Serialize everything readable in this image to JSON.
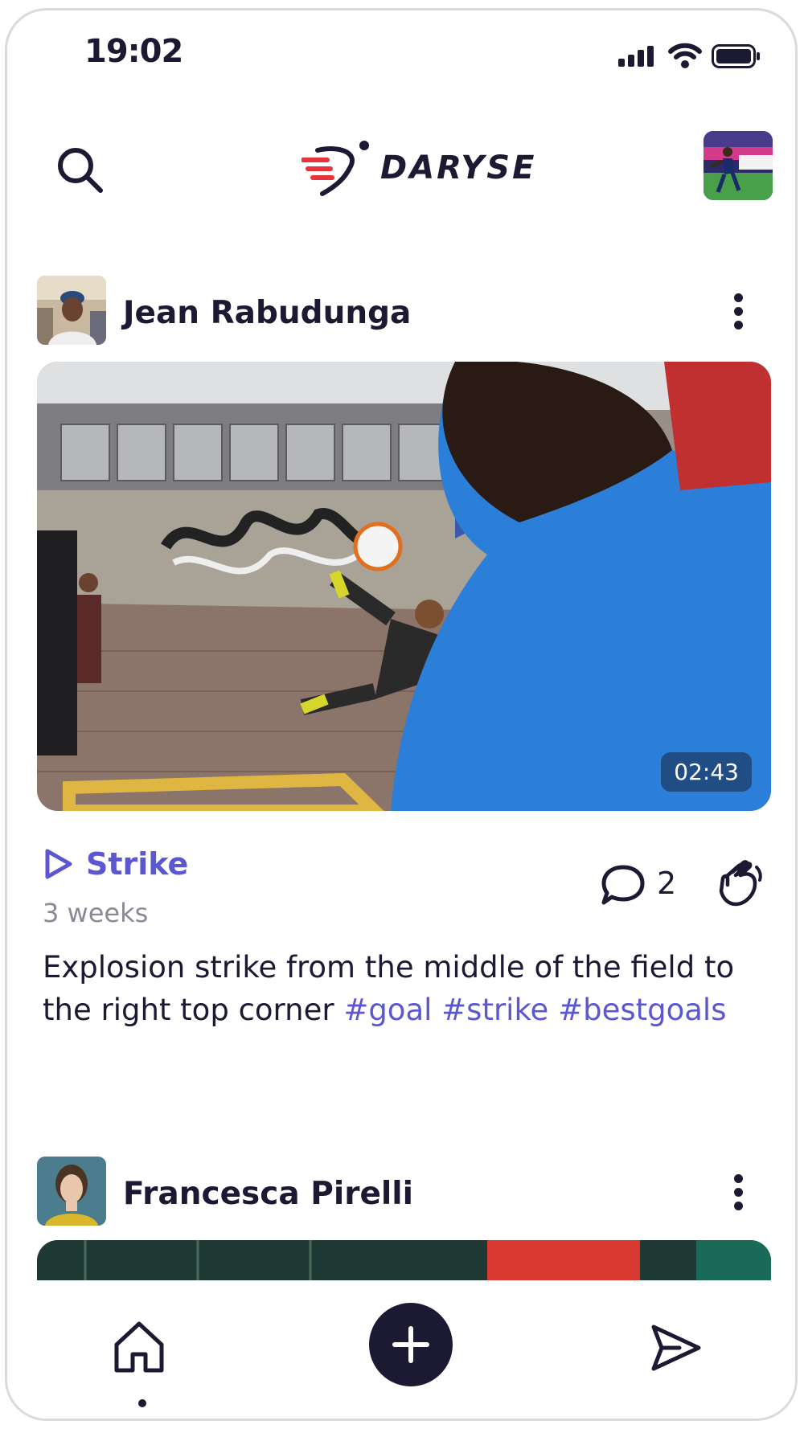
{
  "status_bar": {
    "time": "19:02"
  },
  "header": {
    "brand": "DARYSE",
    "brand_colors": {
      "accent": "#e8323c",
      "dark": "#1c1a33"
    },
    "search_icon": "search-icon",
    "profile_avatar": "profile-avatar"
  },
  "posts": [
    {
      "author": "Jean Rabudunga",
      "media_duration": "02:43",
      "category": "Strike",
      "time_ago": "3 weeks",
      "comment_count": "2",
      "caption_text": "Explosion strike from the middle of the field to the right top corner",
      "hashtags": [
        "#goal",
        "#strike",
        "#bestgoals"
      ]
    },
    {
      "author": "Francesca Pirelli"
    }
  ],
  "bottom_nav": {
    "home_icon": "home-icon",
    "add_icon": "plus-icon",
    "send_icon": "send-icon"
  },
  "colors": {
    "link": "#5b57d0",
    "muted": "#8a8995",
    "text": "#1c1a33"
  }
}
